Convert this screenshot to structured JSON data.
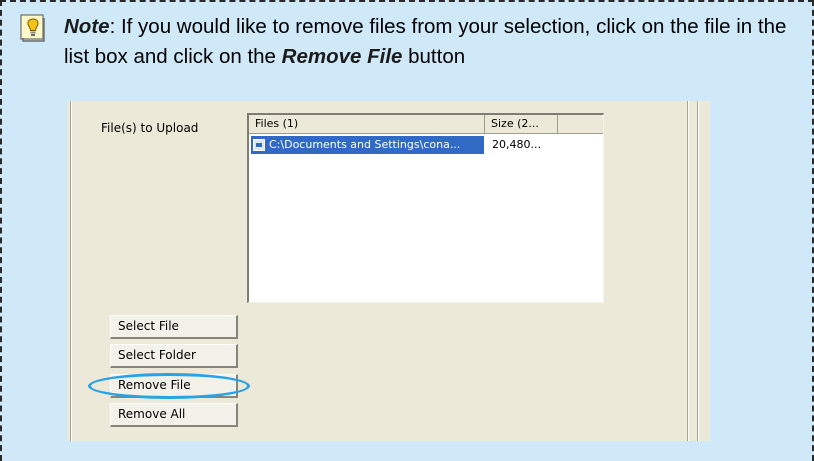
{
  "note": {
    "icon": "lightbulb-note-icon",
    "label": "Note",
    "colon": ":",
    "text_part1": " If you would like to remove files from your selection, click on the file in the list box and click on the ",
    "button_name": "Remove File",
    "text_part2": " button"
  },
  "dialog": {
    "upload_label": "File(s) to Upload",
    "list": {
      "columns": [
        "Files (1)",
        "Size (2..."
      ],
      "rows": [
        {
          "file": "C:\\Documents and Settings\\cona...",
          "size": "20,480..."
        }
      ]
    },
    "buttons": {
      "select_file": "Select File",
      "select_folder": "Select Folder",
      "remove_file": "Remove File",
      "remove_all": "Remove All"
    }
  },
  "colors": {
    "note_background": "#cfe9f9",
    "selection": "#316ac5",
    "highlight_ring": "#2aa3e6",
    "dialog_background": "#ece9d8"
  }
}
